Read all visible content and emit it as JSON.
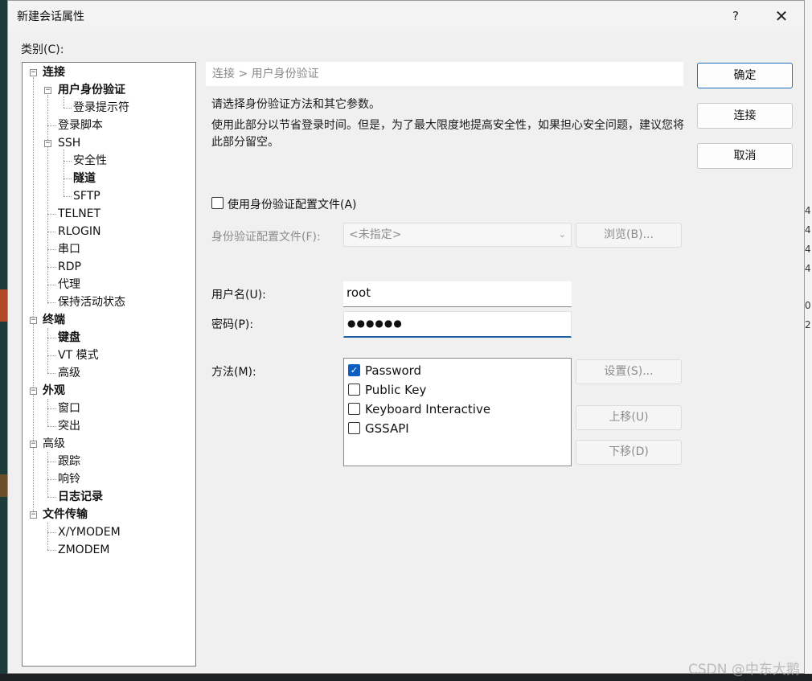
{
  "dialog": {
    "title": "新建会话属性",
    "help_label": "?",
    "close_label": "✕",
    "category_label": "类别(C):"
  },
  "tree": {
    "items": [
      {
        "label": "连接"
      },
      {
        "label": "用户身份验证"
      },
      {
        "label": "登录提示符"
      },
      {
        "label": "登录脚本"
      },
      {
        "label": "SSH"
      },
      {
        "label": "安全性"
      },
      {
        "label": "隧道"
      },
      {
        "label": "SFTP"
      },
      {
        "label": "TELNET"
      },
      {
        "label": "RLOGIN"
      },
      {
        "label": "串口"
      },
      {
        "label": "RDP"
      },
      {
        "label": "代理"
      },
      {
        "label": "保持活动状态"
      },
      {
        "label": "终端"
      },
      {
        "label": "键盘"
      },
      {
        "label": "VT 模式"
      },
      {
        "label": "高级"
      },
      {
        "label": "外观"
      },
      {
        "label": "窗口"
      },
      {
        "label": "突出"
      },
      {
        "label": "高级"
      },
      {
        "label": "跟踪"
      },
      {
        "label": "响铃"
      },
      {
        "label": "日志记录"
      },
      {
        "label": "文件传输"
      },
      {
        "label": "X/YMODEM"
      },
      {
        "label": "ZMODEM"
      }
    ]
  },
  "main": {
    "breadcrumb": "连接 > 用户身份验证",
    "desc1": "请选择身份验证方法和其它参数。",
    "desc2": "使用此部分以节省登录时间。但是，为了最大限度地提高安全性，如果担心安全问题，建议您将此部分留空。",
    "use_profile_label": "使用身份验证配置文件(A)",
    "profile_label": "身份验证配置文件(F):",
    "profile_value": "<未指定>",
    "browse_label": "浏览(B)...",
    "username_label": "用户名(U):",
    "username_value": "root",
    "password_label": "密码(P):",
    "password_value": "●●●●●●",
    "method_label": "方法(M):",
    "methods": [
      {
        "label": "Password",
        "checked": true
      },
      {
        "label": "Public Key",
        "checked": false
      },
      {
        "label": "Keyboard Interactive",
        "checked": false
      },
      {
        "label": "GSSAPI",
        "checked": false
      }
    ],
    "settings_label": "设置(S)...",
    "move_up_label": "上移(U)",
    "move_down_label": "下移(D)"
  },
  "buttons": {
    "ok": "确定",
    "connect": "连接",
    "cancel": "取消"
  },
  "background": {
    "marks": [
      "4",
      "4",
      "4",
      "4",
      "0",
      "2"
    ]
  },
  "watermark": "CSDN @中东大鹅",
  "colors": {
    "accent": "#0b5fc2",
    "dialog_bg": "#f0f0f0"
  }
}
